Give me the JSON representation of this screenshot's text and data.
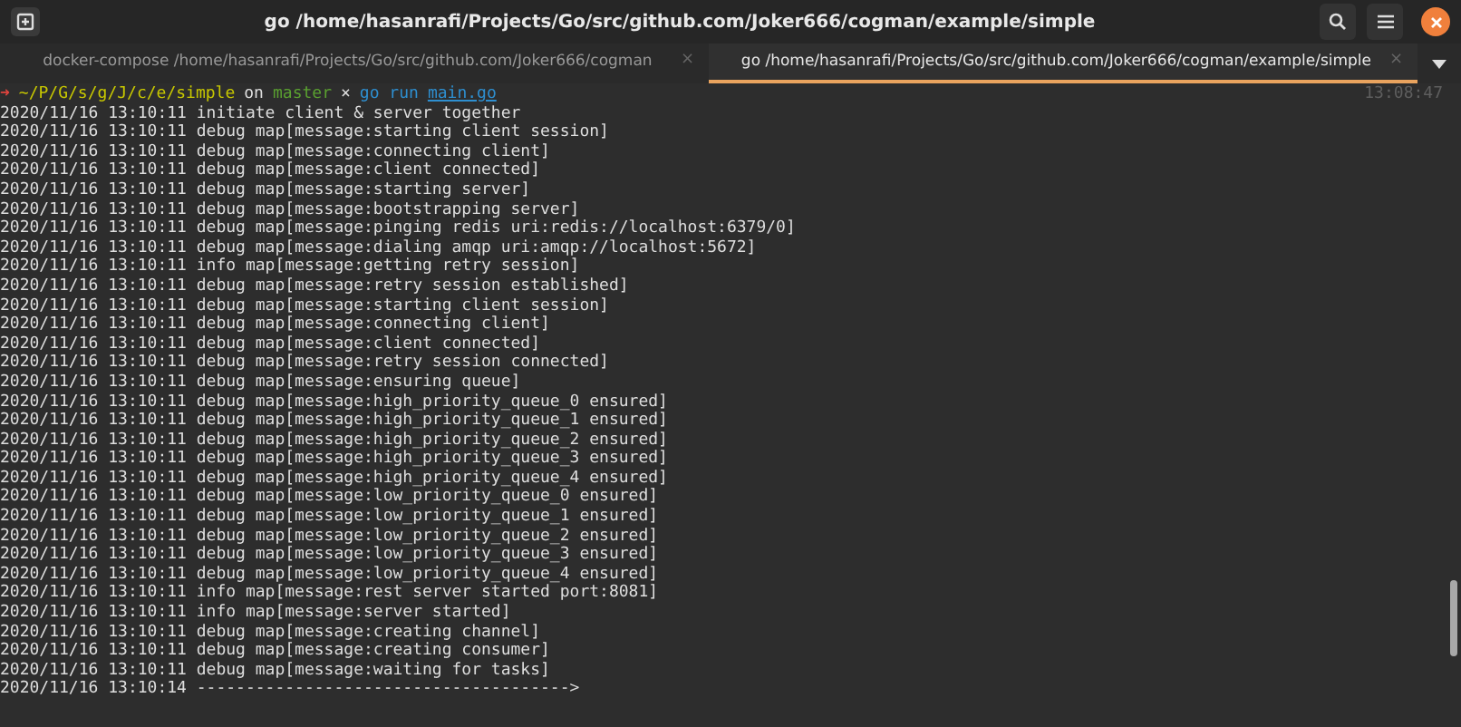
{
  "window": {
    "title": "go /home/hasanrafi/Projects/Go/src/github.com/Joker666/cogman/example/simple"
  },
  "tabs": [
    {
      "label": "docker-compose /home/hasanrafi/Projects/Go/src/github.com/Joker666/cogman",
      "selected": false,
      "close": "×"
    },
    {
      "label": "go /home/hasanrafi/Projects/Go/src/github.com/Joker666/cogman/example/simple",
      "selected": true,
      "close": "×"
    }
  ],
  "prompt": {
    "arrow": "➜",
    "path": "~/P/G/s/g/J/c/e/simple",
    "on": "on",
    "branch": "master",
    "dirty": "×",
    "command": "go run",
    "file": "main.go",
    "time": "13:08:47"
  },
  "output": [
    "2020/11/16 13:10:11 initiate client & server together",
    "2020/11/16 13:10:11 debug map[message:starting client session]",
    "2020/11/16 13:10:11 debug map[message:connecting client]",
    "2020/11/16 13:10:11 debug map[message:client connected]",
    "2020/11/16 13:10:11 debug map[message:starting server]",
    "2020/11/16 13:10:11 debug map[message:bootstrapping server]",
    "2020/11/16 13:10:11 debug map[message:pinging redis uri:redis://localhost:6379/0]",
    "2020/11/16 13:10:11 debug map[message:dialing amqp uri:amqp://localhost:5672]",
    "2020/11/16 13:10:11 info map[message:getting retry session]",
    "2020/11/16 13:10:11 debug map[message:retry session established]",
    "2020/11/16 13:10:11 debug map[message:starting client session]",
    "2020/11/16 13:10:11 debug map[message:connecting client]",
    "2020/11/16 13:10:11 debug map[message:client connected]",
    "2020/11/16 13:10:11 debug map[message:retry session connected]",
    "2020/11/16 13:10:11 debug map[message:ensuring queue]",
    "2020/11/16 13:10:11 debug map[message:high_priority_queue_0 ensured]",
    "2020/11/16 13:10:11 debug map[message:high_priority_queue_1 ensured]",
    "2020/11/16 13:10:11 debug map[message:high_priority_queue_2 ensured]",
    "2020/11/16 13:10:11 debug map[message:high_priority_queue_3 ensured]",
    "2020/11/16 13:10:11 debug map[message:high_priority_queue_4 ensured]",
    "2020/11/16 13:10:11 debug map[message:low_priority_queue_0 ensured]",
    "2020/11/16 13:10:11 debug map[message:low_priority_queue_1 ensured]",
    "2020/11/16 13:10:11 debug map[message:low_priority_queue_2 ensured]",
    "2020/11/16 13:10:11 debug map[message:low_priority_queue_3 ensured]",
    "2020/11/16 13:10:11 debug map[message:low_priority_queue_4 ensured]",
    "2020/11/16 13:10:11 info map[message:rest server started port:8081]",
    "2020/11/16 13:10:11 info map[message:server started]",
    "2020/11/16 13:10:11 debug map[message:creating channel]",
    "2020/11/16 13:10:11 debug map[message:creating consumer]",
    "2020/11/16 13:10:11 debug map[message:waiting for tasks]",
    "2020/11/16 13:10:14 -------------------------------------->"
  ]
}
